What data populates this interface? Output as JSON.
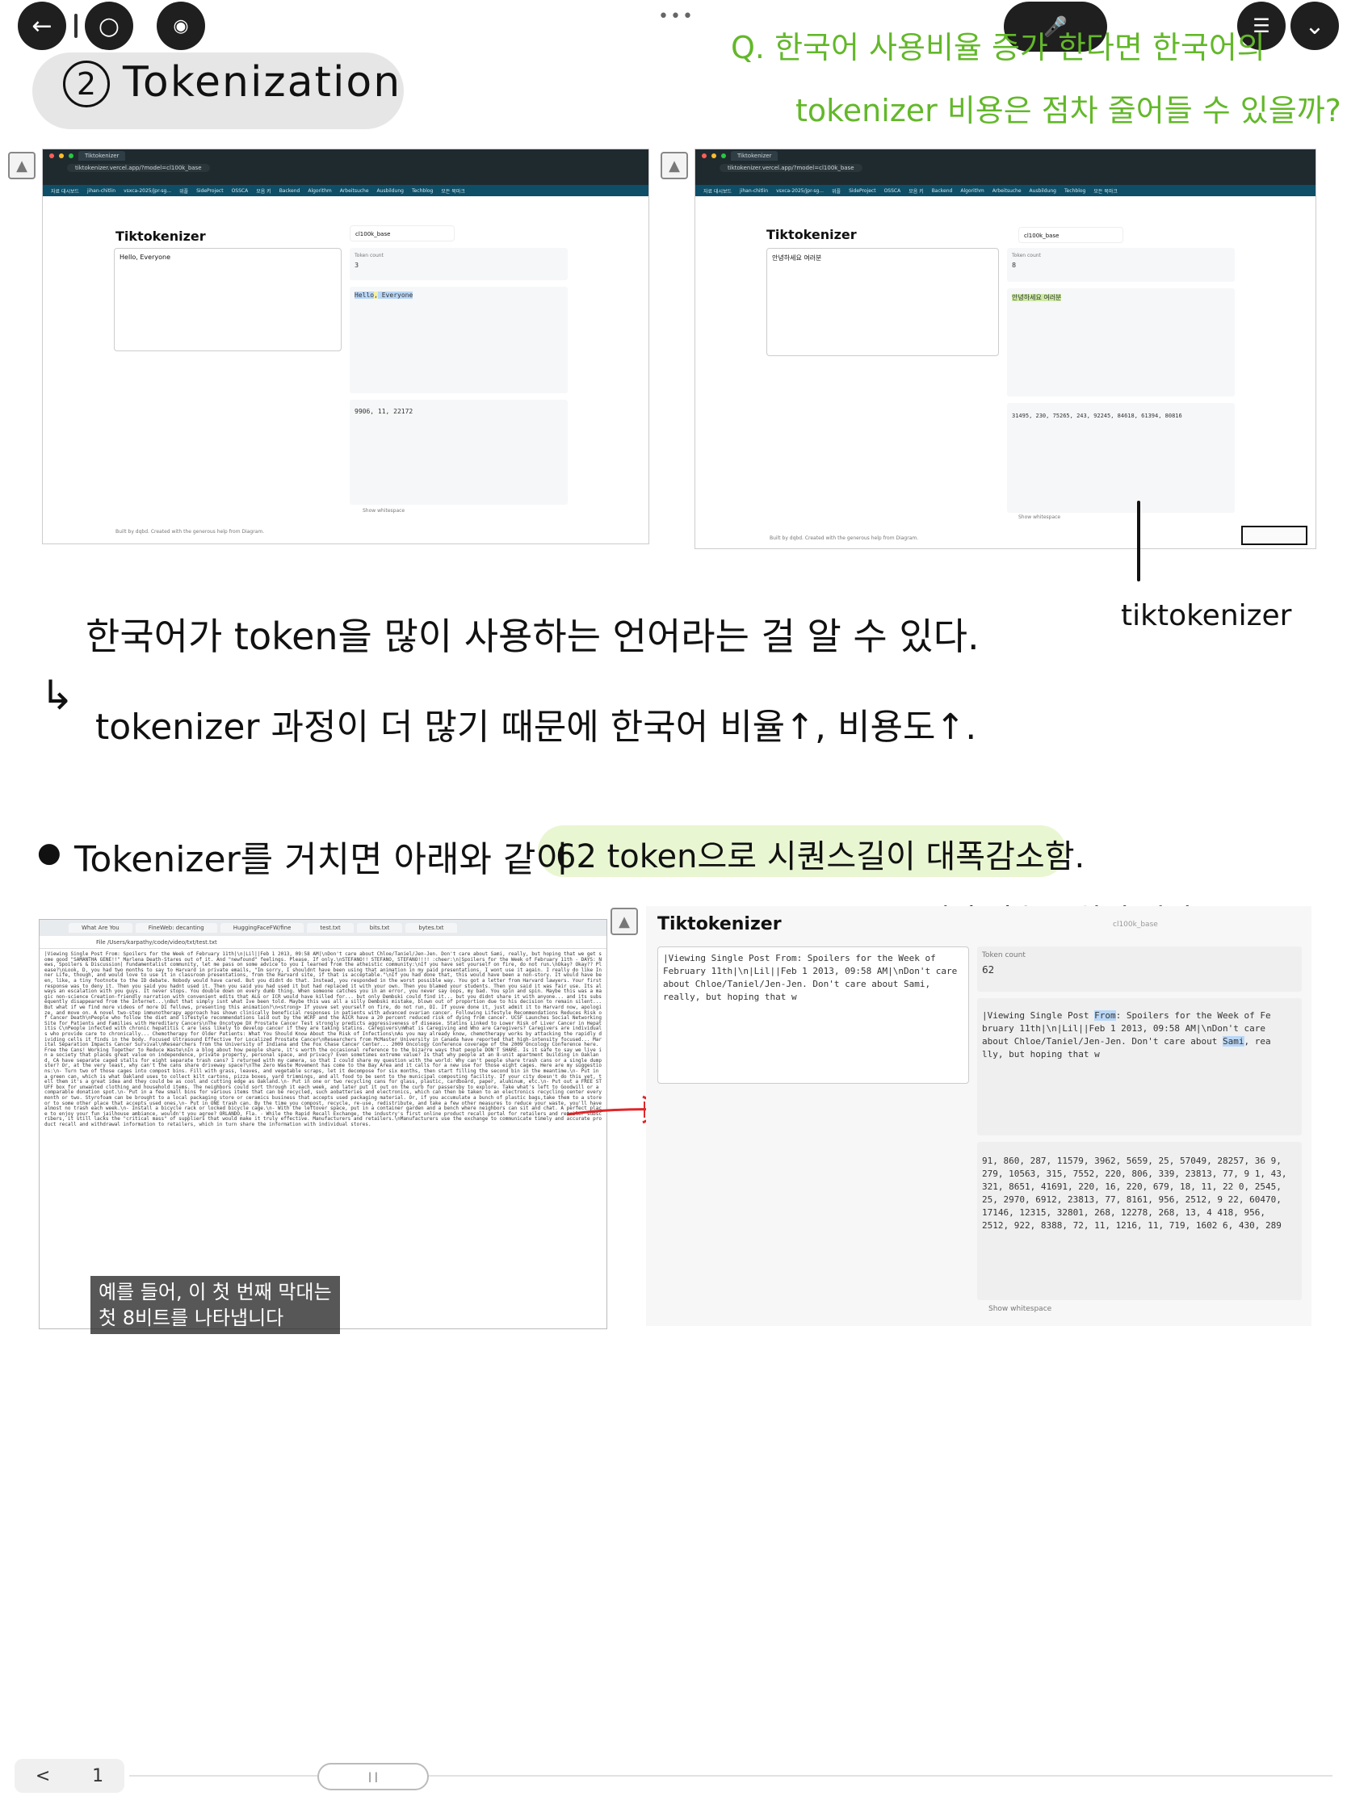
{
  "toolbar": {
    "back_icon": "←",
    "circle_icon": "○",
    "eye_icon": "◉",
    "more_dots": "•••",
    "mic_icon": "🎤",
    "list_icon": "☰",
    "chevron_icon": "⌄"
  },
  "notes": {
    "section_number": "2",
    "section_title": "Tokenization",
    "question_line1": "Q. 한국어 사용비율 증가 한다면 한국어의",
    "question_line2": "tokenizer 비용은 점차 줄어들 수 있을까?",
    "observation": "한국어가 token을 많이 사용하는 언어라는 걸 알 수 있다.",
    "consequence": "tokenizer 과정이 더 많기 때문에 한국어 비율↑, 비용도↑.",
    "tiktokenizer_label": "tiktokenizer",
    "bullet": "Tokenizer를 거치면 아래와 같이",
    "bullet_highlight": "62 token으로 시퀀스길이 대폭감소함.",
    "sequence_note": "(100,277개의 기호, 1차원 시퀀스)"
  },
  "shot1": {
    "tab": "Tiktokenizer",
    "url": "tiktokenizer.vercel.app/?model=cl100k_base",
    "bookmarks": [
      "자료 대시보드",
      "jihan-chitlin",
      "vsxca-2025/jpr-sg...",
      "위플",
      "SideProject",
      "OSSCA",
      "모음 키",
      "Backend",
      "Algorithm",
      "Arbeitsuche",
      "Ausbildung",
      "Techblog",
      "모든 북마크"
    ],
    "app_title": "Tiktokenizer",
    "model": "cl100k_base",
    "input_text": "Hello, Everyone",
    "token_count_label": "Token count",
    "token_count": "3",
    "token_hello": "Hello",
    "token_comma": ",",
    "token_everyone": " Everyone",
    "token_ids": "9906, 11, 22172",
    "show_whitespace": "Show whitespace",
    "footer": "Built by dqbd. Created with the generous help from Diagram."
  },
  "shot2": {
    "tab": "Tiktokenizer",
    "url": "tiktokenizer.vercel.app/?model=cl100k_base",
    "app_title": "Tiktokenizer",
    "model": "cl100k_base",
    "input_text": "안녕하세요 여러분",
    "token_count_label": "Token count",
    "token_count": "8",
    "token_text": "안녕하세요 여러분",
    "token_ids": "31495, 230, 75265, 243, 92245, 84618, 61394, 80816",
    "show_whitespace": "Show whitespace",
    "footer": "Built by dqbd. Created with the generous help from Diagram."
  },
  "doc": {
    "tabs": [
      "What Are You",
      "FineWeb: decanting",
      "HuggingFaceFW/fine",
      "test.txt",
      "bits.txt",
      "bytes.txt"
    ],
    "url": "File /Users/karpathy/code/video/txt/test.txt",
    "text": "|Viewing Single Post From: Spoilers for the Week of February 11th|\\n|Lil||Feb 1 2013, 09:58 AM|\\nDon't care about Chloe/Taniel/Jen-Jen. Don't care about Sami, really, but hoping that we get some good \"SAMANTHA GENE!!\" Marlena Death-Stares out of it. And \"newfound\" feelings. Please. If only.\\nSTEFANO!! STEFANO, STEFANO!!!! :cheer:\\n|Spoilers for the Week of February 11th - DAYS: News, Spoilers & Discussion| Fundamentalist community, let me pass on some advice to you I learned from the atheistic community:\\nIf you have set yourself on fire, do not run.\\nOkay? Okay?? Please?\\nLook, D, you had two months to say to Harvard in private emails, \"Im sorry, I shouldnt have been using that animation in my paid presentations. I wont use it again. I really do like Inner Life, though, and would love to use it in classroom presentations, from the Harvard site, if that is acceptable.\"\\nIf you had done that, this would have been a non-story. It would have been, like, a tiny footnote to the ID debate. Nobody would have cared. But you didnt do that. Instead, you responded in the worst possible way. You got a letter from Harvard lawyers. Your first response was to deny it. Then you said you hadnt used it. Then you said you had used it but had replaced it with your own. Then you blamed your students. Then you said it was fair use. Its always an escalation with you guys. It never stops. You double down on every dumb thing. When someone catches you in an error, you never say oops, my bad. You spin and spin. Maybe this was a magic non-science Creation-friendly narration with convenient edits that ALG or ICR would have killed for... but only Dembski could find it... but you didnt share it with anyone... and its subsequently disappeared from the Internet...\\nBut that simply isnt what Ive been told. Maybe this was all a silly Dembski mistake, blown out of proportion due to his decision to remain silent... But what if we find more videos of more DI fellows, presenting this animation?\\n<strong> If youve set yourself on fire, do not run, DI. If youve done it, just admit it to Harvard now, apologize, and move on. A novel two-step immunotherapy approach has shown clinically beneficial responses in patients with advanced ovarian cancer. Following Lifestyle Recommendations Reduces Risk of Cancer Death\\nPeople who follow the diet and lifestyle recommendations laid out by the WCRF and the AICR have a 20 percent reduced risk of dying from cancer. UCSF Launches Social Networking Site for Patients and Families with Hereditary Cancers\\nThe Oncotype DX Prostate Cancer Test strongly predicts aggressiveness of disease. Statins Linked to Lower Risk of Liver Cancer in Hepatitis C\\nPeople infected with chronic hepatitis C are less likely to develop cancer if they are taking statins. Caregivers\\nWhat is Caregiving and Who are Caregivers? Caregivers are individuals who provide care to chronically... Chemotherapy for Older Patients: What You Should Know About the Risk of Infections\\nAs you may already know, chemotherapy works by attacking the rapidly dividing cells it finds in the body. Focused Ultrasound Effective for Localized Prostate Cancer\\nResearchers from McMaster University in Canada have reported that high-intensity focused... Marital Separation Impacts Cancer Survival\\nResearchers from the University of Indiana and the Fox Chase Cancer Center... 2009 Oncology Conference coverage of the 2009 Oncology Conference here. Free the Cans! Working Together to Reduce Waste\\nIn a blog about how people share, it's worth the occasional reference to the bizarre ways that people DON'T SHARE. Is it safe to say we live in a society that places great value on independence, private property, personal space, and privacy? Even sometimes extreme value? Is that why people at an 8-unit apartment building in Oakland, CA have separate caged stalls for eight separate trash cans? I returned with my camera, so that I could share my question with the world: Why can't people share trash cans or a single dumpster? Or, at the very least, why can't the cans share driveway space?\\nThe Zero Waste Movement has come to the Bay Area and it calls for a new use for those eight cages. Here are my suggestions:\\n- Turn two of those cages into compost bins. Fill with grass, leaves, and vegetable scraps, let it decompose for six months, then start filling the second bin in the meantime.\\n- Put in a green can, which is what Oakland uses to collect kilt cartons, pizza boxes, yard trimmings, and all food to be sent to the municipal composting facility. If your city doesn't do this yet, tell them it's a great idea and they could be as cool and cutting edge as Oakland.\\n- Put in one or two recycling cans for glass, plastic, cardboard, paper, aluminum, etc.\\n- Put out a FREE STUFF box for unwanted clothing and household items. The neighbors could sort through it each week, and later put it out on the curb for passersby to explore. Take what's left to Goodwill or a comparable donation spot.\\n- Put in a few small bins for various items that can be recycled, such aobatteries and electronics, which can then be taken to an electronics recycling center every month or two. Styrofoam can be brought to a local packaging store or ceramics business that accepts used packaging material. Or, if you accumulate a bunch of plastic bags,take them to a store or to some other place that accepts used ones.\\n- Put in ONE trash can. By the time you compost, recycle, re-use, redistribute, and take a few other measures to reduce your waste, you'll have almost no trash each week.\\n- Install a bicycle rack or locked bicycle cage.\\n- With the leftover space, put in a container garden and a bench where neighbors can sit and chat. A perfect place to enjoy your fun jailhouse ambiance, wouldn't you agree? ORLANDO, Fla. - While the Rapid Recall Exchange, the industry's first online product recall portal for retailers and retailer subscribers, it still lacks the \"critical mass\" of suppliers that would make it truly effective. Manufacturers and retailers.\\nManufacturers use the exchange to communicate timely and accurate product recall and withdrawal information to retailers, which in turn share the information with individual stores."
  },
  "caption": {
    "line1": "예를 들어, 이 첫 번째 막대는",
    "line2": "첫 8비트를 나타냅니다"
  },
  "shot3": {
    "app_title": "Tiktokenizer",
    "model": "cl100k_base",
    "input_text": "|Viewing Single Post From: Spoilers for the Week of February 11th|\\n|Lil||Feb 1 2013, 09:58 AM|\\nDon't care about Chloe/Taniel/Jen-Jen. Don't care about Sami, really, but hoping that w",
    "token_count_label": "Token count",
    "token_count": "62",
    "token_text_a": "|Viewing Single Post ",
    "token_text_from": "From",
    "token_text_b": ": Spoilers for the Week of Fe bruary 11th|\\n|Lil||Feb 1 2013, 09:58 AM|\\nDon't care about Chloe/Taniel/Jen-Jen. Don't care about ",
    "token_text_sami": "Sami",
    "token_text_c": ", rea lly, but hoping that w",
    "token_ids": "91, 860, 287, 11579, 3962, 5659, 25, 57049, 28257, 36 9, 279, 10563, 315, 7552, 220, 806, 339, 23813, 77, 9 1, 43, 321, 8651, 41691, 220, 16, 220, 679, 18, 11, 22 0, 2545, 25, 2970, 6912, 23813, 77, 8161, 956, 2512, 9 22, 60470, 17146, 12315, 32801, 268, 12278, 268, 13, 4 418, 956, 2512, 922, 8388, 72, 11, 1216, 11, 719, 1602 6, 430, 289",
    "show_whitespace": "Show whitespace"
  },
  "pager": {
    "prev_icon": "<",
    "page": "1",
    "thumb": "| |"
  },
  "colors": {
    "green_ink": "#63b82a",
    "highlight_green": "#e9f6d2",
    "arrow_red": "#e0262a"
  }
}
